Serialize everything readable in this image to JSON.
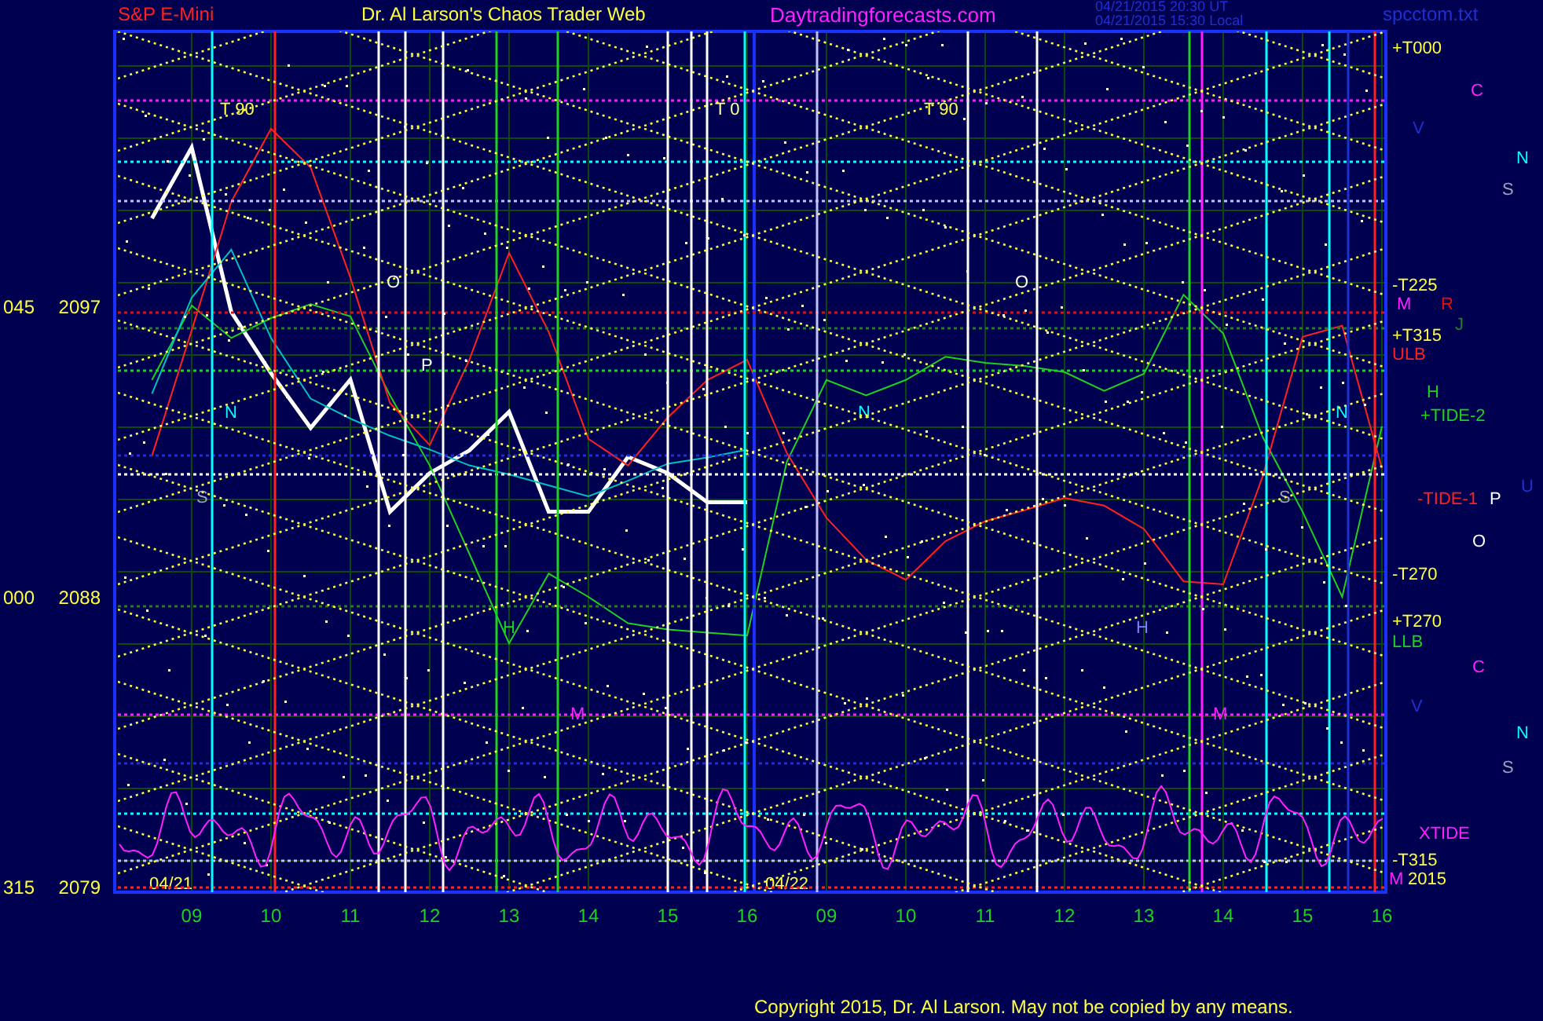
{
  "header": {
    "instrument": "S&P E-Mini",
    "title": "Dr. Al Larson's Chaos Trader Web",
    "website": "Daytradingforecasts.com",
    "timestamps": [
      "04/21/2015 20:30 UT",
      "04/21/2015 15:30 Local"
    ],
    "file": "spcctom.txt"
  },
  "chart": {
    "chart_data": {
      "type": "line",
      "categories": [
        null,
        "09",
        null,
        "10",
        null,
        "11",
        null,
        "12",
        null,
        "13",
        null,
        "14",
        null,
        "15",
        null,
        "16",
        null,
        "09",
        null,
        "10",
        null,
        "11",
        null,
        "12",
        null,
        "13",
        null,
        "14",
        null,
        "15",
        null,
        "16"
      ],
      "series": [
        {
          "color": "#ffffff",
          "values": [
            2099.8,
            2102,
            2096.9,
            2095,
            2093.3,
            2094.8,
            2090.7,
            2091.9,
            2092.6,
            2093.8,
            2090.7,
            2090.7,
            2092.4,
            2091.9,
            2091,
            2091,
            null,
            null,
            null,
            null,
            null,
            null,
            null,
            null,
            null,
            null,
            null,
            null,
            null,
            null,
            null,
            null
          ]
        },
        {
          "color": "#20d020",
          "values": [
            2094.79,
            2097.1,
            2096.09,
            2096.71,
            2097.14,
            2096.76,
            2094.31,
            2092.14,
            2089.4,
            2086.62,
            2088.78,
            2088.06,
            2087.24,
            2087.05,
            2086.95,
            2086.86,
            2092.24,
            2094.79,
            2094.31,
            2094.79,
            2095.51,
            2095.32,
            2095.22,
            2095.03,
            2094.45,
            2094.98,
            2097.43,
            2096.23,
            2093.01,
            2090.7,
            2088.06,
            2093.35
          ]
        },
        {
          "color": "#ff2020",
          "values": [
            2092.43,
            2096.33,
            2100.32,
            2102.58,
            2101.38,
            2097.96,
            2094.07,
            2092.77,
            2095.41,
            2098.73,
            2096.28,
            2092.96,
            2092.14,
            2093.63,
            2094.79,
            2095.41,
            2092.53,
            2090.51,
            2089.21,
            2088.59,
            2089.79,
            2090.41,
            2090.75,
            2091.13,
            2090.89,
            2090.17,
            2088.54,
            2088.45,
            2091.81,
            2096.13,
            2096.47,
            2092.05
          ]
        },
        {
          "color": "#00c0c0",
          "values": [
            2094.36,
            2097.34,
            2098.83,
            2096.09,
            2094.21,
            2093.59,
            2093.06,
            2092.63,
            2092.14,
            2091.86,
            2091.52,
            2091.18,
            2091.66,
            2092.19,
            2092.38,
            2092.63,
            null,
            null,
            null,
            null,
            null,
            null,
            null,
            null,
            null,
            null,
            null,
            null,
            null,
            null,
            null,
            null
          ]
        }
      ],
      "ylim": [
        2078.9,
        2105.6
      ],
      "yticks": [
        2097,
        2088,
        2079
      ],
      "grid": true
    },
    "angle_labels": [
      "045",
      "000",
      "315"
    ],
    "labels": [
      {
        "text": "T 90",
        "color": "#ffff40"
      },
      {
        "text": "T 0",
        "color": "#ffffa0"
      },
      {
        "text": "T 90",
        "color": "#ffff40"
      },
      {
        "text": "O",
        "color": "#ffffff"
      },
      {
        "text": "P",
        "color": "#ffffff"
      },
      {
        "text": "N",
        "color": "#00ffff"
      },
      {
        "text": "S",
        "color": "#a0a0c0"
      },
      {
        "text": "H",
        "color": "#20d020"
      },
      {
        "text": "M",
        "color": "#ff20ff"
      },
      {
        "text": "O",
        "color": "#ffffff"
      },
      {
        "text": "N",
        "color": "#00ffff"
      },
      {
        "text": "H",
        "color": "#8080ff"
      },
      {
        "text": "M",
        "color": "#ff20ff"
      },
      {
        "text": "N",
        "color": "#00ffff"
      },
      {
        "text": "S",
        "color": "#a0a0c0"
      },
      {
        "text": "04/21",
        "color": "#ffff40"
      },
      {
        "text": "04/22",
        "color": "#ffff40"
      },
      {
        "text": "+T000",
        "color": "#ffff40"
      },
      {
        "text": "C",
        "color": "#ff20ff"
      },
      {
        "text": "V",
        "color": "#2030d0"
      },
      {
        "text": "N",
        "color": "#00ffff"
      },
      {
        "text": "S",
        "color": "#a0a0c0"
      },
      {
        "text": "-T225",
        "color": "#ffff40"
      },
      {
        "text": "M",
        "color": "#ff20ff"
      },
      {
        "text": "R",
        "color": "#e01010"
      },
      {
        "text": "J",
        "color": "#208020"
      },
      {
        "text": "+T315",
        "color": "#ffff40"
      },
      {
        "text": "ULB",
        "color": "#ff2020"
      },
      {
        "text": "H",
        "color": "#20d020"
      },
      {
        "text": "+TIDE-2",
        "color": "#20d020"
      },
      {
        "text": "U",
        "color": "#2030d0"
      },
      {
        "text": "-TIDE-1",
        "color": "#ff2020"
      },
      {
        "text": "P",
        "color": "#ffffff"
      },
      {
        "text": "O",
        "color": "#ffffff"
      },
      {
        "text": "-T270",
        "color": "#ffff40"
      },
      {
        "text": "+T270",
        "color": "#ffff40"
      },
      {
        "text": "LLB",
        "color": "#20d020"
      },
      {
        "text": "C",
        "color": "#ff20ff"
      },
      {
        "text": "V",
        "color": "#2030d0"
      },
      {
        "text": "N",
        "color": "#00ffff"
      },
      {
        "text": "S",
        "color": "#a0a0c0"
      },
      {
        "text": "XTIDE",
        "color": "#ff20ff"
      },
      {
        "text": "-T315",
        "color": "#ffff40"
      },
      {
        "text": "M",
        "color": "#ff20ff"
      },
      {
        "text": "2015",
        "color": "#ffff40"
      }
    ]
  },
  "copyright": "Copyright 2015, Dr. Al Larson. May not be copied by any means."
}
